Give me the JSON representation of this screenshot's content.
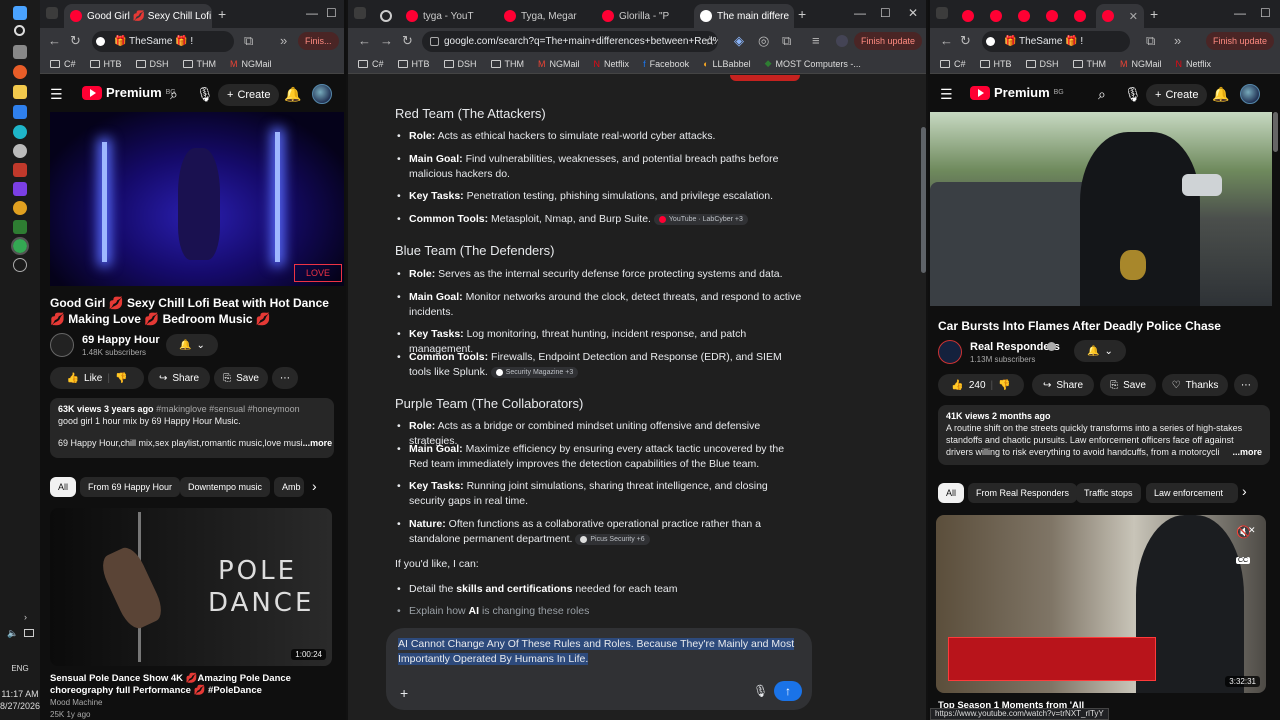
{
  "taskbar": {
    "time": "11:17 AM",
    "date": "8/27/2026",
    "language": "ENG"
  },
  "left_window": {
    "tab_title": "Good Girl 💋 Sexy Chill Lofi Be",
    "omnibox": "🎁 TheSame 🎁 !",
    "finish_label": "Finis...",
    "bookmarks": [
      "C#",
      "HTB",
      "DSH",
      "THM",
      "NGMail"
    ],
    "yt_logo": "Premium",
    "yt_logo_region": "BG",
    "create_label": "Create",
    "video_title": "Good Girl 💋 Sexy Chill Lofi Beat with Hot Dance 💋 Making Love 💋 Bedroom Music 💋",
    "channel_name": "69 Happy Hour",
    "channel_subs": "1.48K subscribers",
    "like_label": "Like",
    "share_label": "Share",
    "save_label": "Save",
    "desc_stats": "63K views  3 years ago",
    "desc_tags": "#makinglove #sensual #honeymoon",
    "desc_line1": "good girl 1 hour mix by 69 Happy Hour Music.",
    "desc_line2": "69 Happy Hour,chill mix,sex playlist,romantic music,love musi",
    "more_label": "...more",
    "chips": [
      "All",
      "From 69 Happy Hour",
      "Downtempo music",
      "Amb"
    ],
    "next_video": {
      "thumb_text_1": "POLE",
      "thumb_text_2": "DANCE",
      "duration": "1:00:24",
      "title": "Sensual Pole Dance Show 4K 💋Amazing Pole Dance choreography full Performance 💋 #PoleDance",
      "channel": "Mood Machine",
      "meta": "25K  1y ago"
    }
  },
  "middle_window": {
    "tabs": [
      "tyga - YouT",
      "Tyga, Megar",
      "Glorilla - \"P",
      "The main differe"
    ],
    "omnibox": "google.com/search?q=The+main+differences+between+Red%...",
    "finish_label": "Finish update",
    "bookmarks": [
      "C#",
      "HTB",
      "DSH",
      "THM",
      "NGMail",
      "Netflix",
      "Facebook",
      "LLBabbel",
      "MOST Computers -..."
    ],
    "sections": [
      {
        "heading": "Red Team (The Attackers)",
        "items": [
          {
            "label": "Role:",
            "text": " Acts as ethical hackers to simulate real-world cyber attacks."
          },
          {
            "label": "Main Goal:",
            "text": " Find vulnerabilities, weaknesses, and potential breach paths before malicious hackers do."
          },
          {
            "label": "Key Tasks:",
            "text": " Penetration testing, phishing simulations, and privilege escalation."
          },
          {
            "label": "Common Tools:",
            "text": " Metasploit, Nmap, and Burp Suite.",
            "source": "YouTube · LabCyber +3"
          }
        ]
      },
      {
        "heading": "Blue Team (The Defenders)",
        "items": [
          {
            "label": "Role:",
            "text": " Serves as the internal security defense force protecting systems and data."
          },
          {
            "label": "Main Goal:",
            "text": " Monitor networks around the clock, detect threats, and respond to active incidents."
          },
          {
            "label": "Key Tasks:",
            "text": " Log monitoring, threat hunting, incident response, and patch management."
          },
          {
            "label": "Common Tools:",
            "text": " Firewalls, Endpoint Detection and Response (EDR), and SIEM tools like Splunk.",
            "source": "Security Magazine +3"
          }
        ]
      },
      {
        "heading": "Purple Team (The Collaborators)",
        "items": [
          {
            "label": "Role:",
            "text": " Acts as a bridge or combined mindset uniting offensive and defensive strategies."
          },
          {
            "label": "Main Goal:",
            "text": " Maximize efficiency by ensuring every attack tactic uncovered by the Red team immediately improves the detection capabilities of the Blue team."
          },
          {
            "label": "Key Tasks:",
            "text": " Running joint simulations, sharing threat intelligence, and closing security gaps in real time."
          },
          {
            "label": "Nature:",
            "text": " Often functions as a collaborative operational practice rather than a standalone permanent department.",
            "source": "Picus Security +6"
          }
        ]
      }
    ],
    "followup_intro": "If you'd like, I can:",
    "followup_1_pre": "Detail the ",
    "followup_1_bold": "skills and certifications",
    "followup_1_post": " needed for each team",
    "followup_2_pre": "Explain how ",
    "followup_2_bold": "AI",
    "followup_2_post": " is changing these roles",
    "composer_text": "AI Cannot Change Any Of These Rules and Roles. Because They're Mainly and Most Importantly Operated By Humans In Life."
  },
  "right_window": {
    "omnibox": "🎁 TheSame 🎁 !",
    "finish_label": "Finish update",
    "bookmarks": [
      "C#",
      "HTB",
      "DSH",
      "THM",
      "NGMail",
      "Netflix"
    ],
    "yt_logo": "Premium",
    "yt_logo_region": "BG",
    "create_label": "Create",
    "video_title": "Car Bursts Into Flames After Deadly Police Chase",
    "channel_name": "Real Responders",
    "channel_subs": "1.13M subscribers",
    "like_count": "240",
    "share_label": "Share",
    "save_label": "Save",
    "thanks_label": "Thanks",
    "desc_stats": "41K views  2 months ago",
    "desc_text": "A routine shift on the streets quickly transforms into a series of high-stakes standoffs and chaotic pursuits. Law enforcement officers face off against drivers willing to risk everything to avoid handcuffs, from a motorcycli",
    "more_label": "...more",
    "chips": [
      "All",
      "From Real Responders",
      "Traffic stops",
      "Law enforcement"
    ],
    "next_video": {
      "duration": "3:32:31",
      "title": "Top Season 1 Moments from 'All",
      "cc": "CC"
    },
    "status_url": "https://www.youtube.com/watch?v=trNXT_rlTyY"
  },
  "colors": {
    "yt_red": "#ff0033",
    "accent_blue": "#8ab4f8",
    "finish_red": "#ff8a80"
  }
}
